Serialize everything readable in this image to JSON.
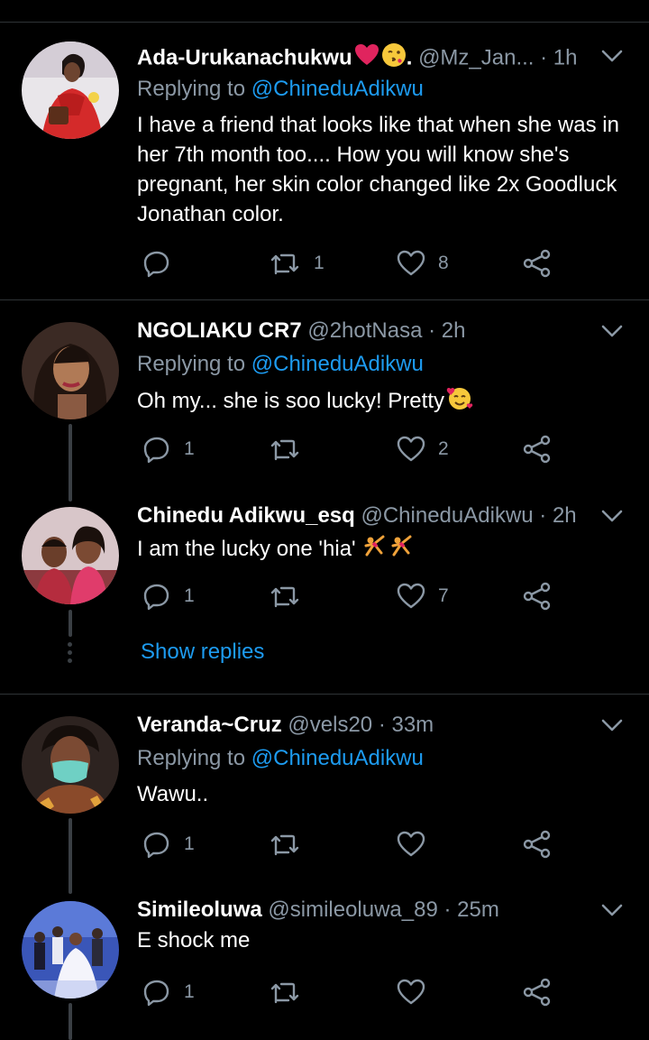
{
  "colors": {
    "background": "#000000",
    "text_primary": "#ffffff",
    "text_secondary": "#8b98a5",
    "link": "#1d9bf0",
    "divider": "#2f3336",
    "heart_emoji": "#e0245e"
  },
  "tweets": [
    {
      "name": "Ada-Urukanachukwu",
      "name_emojis": [
        "red-heart-icon",
        "kissing-face-icon"
      ],
      "name_suffix": ".",
      "handle": "@Mz_Jan...",
      "time": "· 1h",
      "replying_prefix": "Replying to",
      "replying_to": "@ChineduAdikwu",
      "text": "I have a friend that looks like that when she was in her 7th month too.... How you will know she's pregnant, her skin color changed like 2x Goodluck Jonathan color.",
      "reply_count": "",
      "retweet_count": "1",
      "like_count": "8"
    },
    {
      "name": "NGOLIAKU CR7",
      "handle": "@2hotNasa",
      "time": "· 2h",
      "replying_prefix": "Replying to",
      "replying_to": "@ChineduAdikwu",
      "text": "Oh my... she is soo lucky! Pretty",
      "text_emoji": "smiling-face-with-hearts-icon",
      "reply_count": "1",
      "retweet_count": "",
      "like_count": "2"
    },
    {
      "name": "Chinedu Adikwu_esq",
      "handle": "@ChineduAdikwu",
      "time": "· 2h",
      "text": "I am the lucky one 'hia'",
      "text_emoji": "person-cartwheeling-icon",
      "reply_count": "1",
      "retweet_count": "",
      "like_count": "7"
    },
    {
      "name": "Veranda~Cruz",
      "handle": "@vels20",
      "time": "· 33m",
      "replying_prefix": "Replying to",
      "replying_to": "@ChineduAdikwu",
      "text": "Wawu..",
      "reply_count": "1",
      "retweet_count": "",
      "like_count": ""
    },
    {
      "name": "Simileoluwa",
      "handle": "@simileoluwa_89",
      "time": "· 25m",
      "text": "E shock me",
      "reply_count": "1",
      "retweet_count": "",
      "like_count": ""
    }
  ],
  "show_replies_label": "Show replies",
  "icons": {
    "reply": "reply-icon",
    "retweet": "retweet-icon",
    "like": "heart-icon",
    "share": "share-icon",
    "more": "chevron-down-icon"
  }
}
